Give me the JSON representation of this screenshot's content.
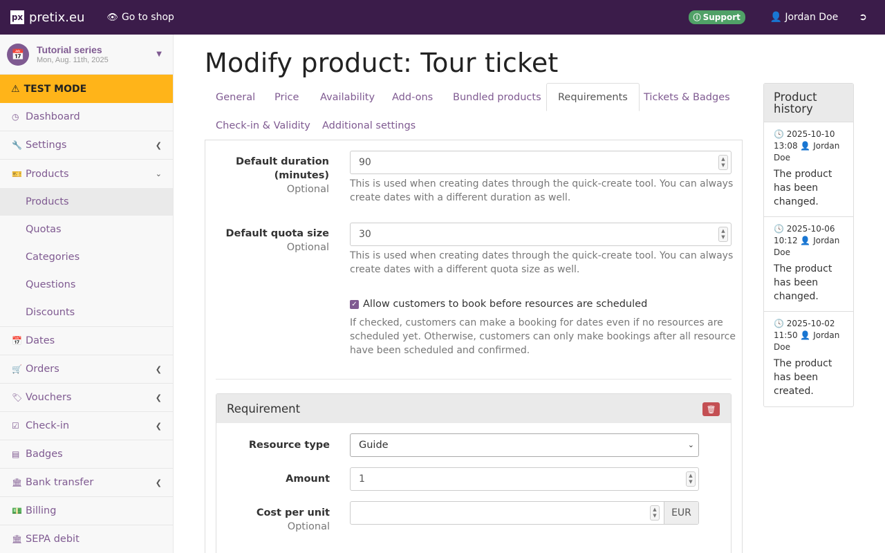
{
  "topbar": {
    "brand_logo": "px",
    "brand_name": "pretix.eu",
    "go_to_shop": "Go to shop",
    "support": "Support",
    "user": "Jordan Doe"
  },
  "sidebar": {
    "event_name": "Tutorial series",
    "event_date": "Mon, Aug. 11th, 2025",
    "test_mode": "TEST MODE",
    "items": {
      "dashboard": "Dashboard",
      "settings": "Settings",
      "products": "Products",
      "dates": "Dates",
      "orders": "Orders",
      "vouchers": "Vouchers",
      "checkin": "Check-in",
      "badges": "Badges",
      "bank_transfer": "Bank transfer",
      "billing": "Billing",
      "sepa": "SEPA debit"
    },
    "products_sub": {
      "products": "Products",
      "quotas": "Quotas",
      "categories": "Categories",
      "questions": "Questions",
      "discounts": "Discounts"
    }
  },
  "main": {
    "title": "Modify product: Tour ticket",
    "tabs": {
      "general": "General",
      "price": "Price",
      "availability": "Availability",
      "addons": "Add-ons",
      "bundled": "Bundled products",
      "requirements": "Requirements",
      "tickets": "Tickets & Badges",
      "checkin": "Check-in & Validity",
      "additional": "Additional settings"
    },
    "form": {
      "duration_label": "Default duration (minutes)",
      "duration_optional": "Optional",
      "duration_value": "90",
      "duration_help": "This is used when creating dates through the quick-create tool. You can always create dates with a different duration as well.",
      "quota_label": "Default quota size",
      "quota_optional": "Optional",
      "quota_value": "30",
      "quota_help": "This is used when creating dates through the quick-create tool. You can always create dates with a different quota size as well.",
      "allow_label": "Allow customers to book before resources are scheduled",
      "allow_checked": true,
      "allow_help": "If checked, customers can make a booking for dates even if no resources are scheduled yet. Otherwise, customers can only make bookings after all resource have been scheduled and confirmed."
    },
    "requirement": {
      "heading": "Requirement",
      "resource_type_label": "Resource type",
      "resource_type_value": "Guide",
      "amount_label": "Amount",
      "amount_value": "1",
      "cost_label": "Cost per unit",
      "cost_optional": "Optional",
      "cost_value": "",
      "cost_currency": "EUR"
    }
  },
  "history": {
    "title": "Product history",
    "entries": [
      {
        "date": "2025-10-10 13:08",
        "user": "Jordan Doe",
        "text": "The product has been changed."
      },
      {
        "date": "2025-10-06 10:12",
        "user": "Jordan Doe",
        "text": "The product has been changed."
      },
      {
        "date": "2025-10-02 11:50",
        "user": "Jordan Doe",
        "text": "The product has been created."
      }
    ]
  }
}
